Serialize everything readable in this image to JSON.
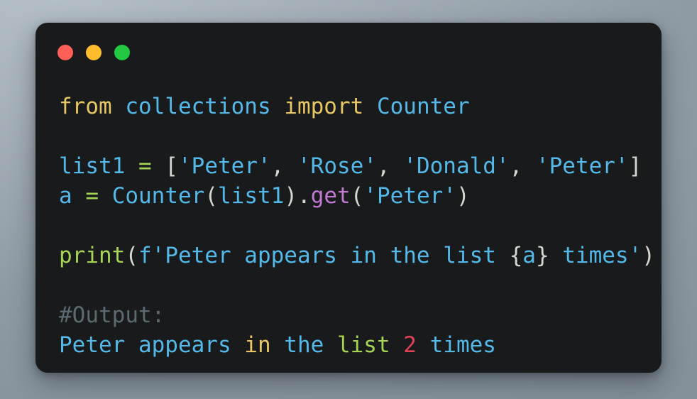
{
  "window": {
    "controls": [
      {
        "name": "close",
        "color": "#ff5f56"
      },
      {
        "name": "minimize",
        "color": "#ffbd2e"
      },
      {
        "name": "maximize",
        "color": "#21c840"
      }
    ],
    "background_color": "#181a1b"
  },
  "code": {
    "language": "python",
    "full_text": "from collections import Counter\n\nlist1 = ['Peter', 'Rose', 'Donald', 'Peter']\na = Counter(list1).get('Peter')\n\nprint(f'Peter appears in the list {a} times')\n\n#Output:\nPeter appears in the list 2 times",
    "lines": [
      {
        "index": 1,
        "tokens": [
          {
            "text": "from",
            "type": "keyword"
          },
          {
            "text": " ",
            "type": "plain"
          },
          {
            "text": "collections",
            "type": "identifier"
          },
          {
            "text": " ",
            "type": "plain"
          },
          {
            "text": "import",
            "type": "keyword"
          },
          {
            "text": " ",
            "type": "plain"
          },
          {
            "text": "Counter",
            "type": "identifier"
          }
        ]
      },
      {
        "index": 2,
        "tokens": []
      },
      {
        "index": 3,
        "tokens": [
          {
            "text": "list1",
            "type": "identifier"
          },
          {
            "text": " ",
            "type": "plain"
          },
          {
            "text": "=",
            "type": "operator"
          },
          {
            "text": " ",
            "type": "plain"
          },
          {
            "text": "[",
            "type": "punctuation"
          },
          {
            "text": "'Peter'",
            "type": "string"
          },
          {
            "text": ", ",
            "type": "punctuation"
          },
          {
            "text": "'Rose'",
            "type": "string"
          },
          {
            "text": ", ",
            "type": "punctuation"
          },
          {
            "text": "'Donald'",
            "type": "string"
          },
          {
            "text": ", ",
            "type": "punctuation"
          },
          {
            "text": "'Peter'",
            "type": "string"
          },
          {
            "text": "]",
            "type": "punctuation"
          }
        ]
      },
      {
        "index": 4,
        "tokens": [
          {
            "text": "a",
            "type": "identifier"
          },
          {
            "text": " ",
            "type": "plain"
          },
          {
            "text": "=",
            "type": "operator"
          },
          {
            "text": " ",
            "type": "plain"
          },
          {
            "text": "Counter",
            "type": "identifier"
          },
          {
            "text": "(",
            "type": "punctuation"
          },
          {
            "text": "list1",
            "type": "identifier"
          },
          {
            "text": ")",
            "type": "punctuation"
          },
          {
            "text": ".",
            "type": "punctuation"
          },
          {
            "text": "get",
            "type": "method"
          },
          {
            "text": "(",
            "type": "punctuation"
          },
          {
            "text": "'Peter'",
            "type": "string"
          },
          {
            "text": ")",
            "type": "punctuation"
          }
        ]
      },
      {
        "index": 5,
        "tokens": []
      },
      {
        "index": 6,
        "tokens": [
          {
            "text": "print",
            "type": "function"
          },
          {
            "text": "(",
            "type": "punctuation"
          },
          {
            "text": "f'Peter appears in the list ",
            "type": "string"
          },
          {
            "text": "{",
            "type": "punctuation"
          },
          {
            "text": "a",
            "type": "identifier"
          },
          {
            "text": "}",
            "type": "punctuation"
          },
          {
            "text": " times'",
            "type": "string"
          },
          {
            "text": ")",
            "type": "punctuation"
          }
        ]
      },
      {
        "index": 7,
        "tokens": []
      },
      {
        "index": 8,
        "tokens": [
          {
            "text": "#Output:",
            "type": "comment"
          }
        ]
      },
      {
        "index": 9,
        "tokens": [
          {
            "text": "Peter appears ",
            "type": "identifier"
          },
          {
            "text": "in",
            "type": "keyword"
          },
          {
            "text": " the ",
            "type": "identifier"
          },
          {
            "text": "list",
            "type": "function"
          },
          {
            "text": " ",
            "type": "plain"
          },
          {
            "text": "2",
            "type": "number"
          },
          {
            "text": " times",
            "type": "identifier"
          }
        ]
      }
    ]
  },
  "theme": {
    "keyword": "#e7c663",
    "identifier": "#54b9e8",
    "string": "#54b9e8",
    "operator": "#a6d454",
    "punctuation": "#d7d7d2",
    "function": "#a6d454",
    "method": "#c27ad4",
    "comment": "#5c6a70",
    "number": "#e0415a",
    "plain": "#d7d7d2",
    "background": "#181a1b"
  }
}
